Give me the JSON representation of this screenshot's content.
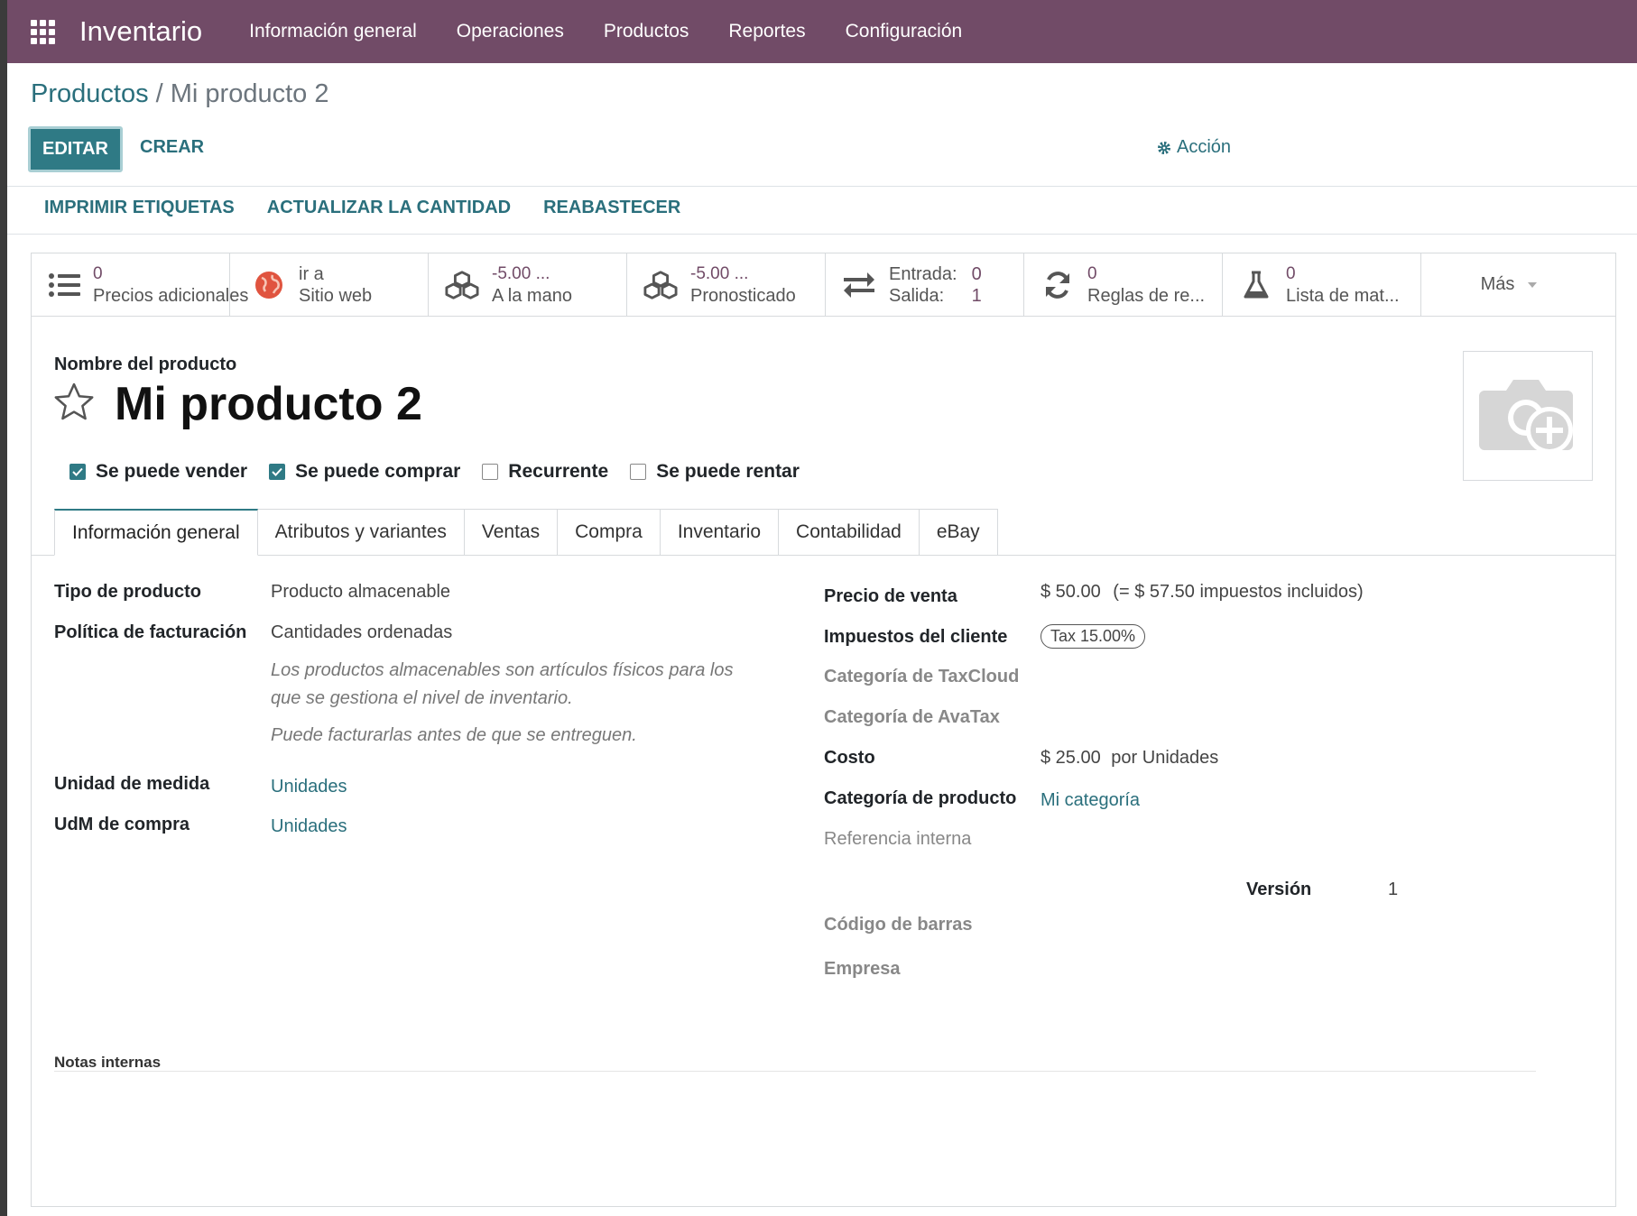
{
  "navbar": {
    "brand": "Inventario",
    "menu": [
      "Información general",
      "Operaciones",
      "Productos",
      "Reportes",
      "Configuración"
    ]
  },
  "breadcrumb": {
    "parent": "Productos",
    "separator": " / ",
    "current": "Mi producto 2"
  },
  "control": {
    "edit": "EDITAR",
    "create": "CREAR",
    "action": "Acción"
  },
  "statusbar_buttons": [
    "IMPRIMIR ETIQUETAS",
    "ACTUALIZAR LA CANTIDAD",
    "REABASTECER"
  ],
  "smart_buttons": {
    "extra_prices": {
      "value": "0",
      "label": "Precios adicionales",
      "icon": "list-icon"
    },
    "website": {
      "value": "ir a",
      "label": "Sitio web",
      "icon": "globe-icon"
    },
    "on_hand": {
      "value": "-5.00 ...",
      "label": "A la mano",
      "icon": "cubes-icon"
    },
    "forecast": {
      "value": "-5.00 ...",
      "label": "Pronosticado",
      "icon": "cubes-icon"
    },
    "in_out": {
      "in_label": "Entrada:",
      "in_value": "0",
      "out_label": "Salida:",
      "out_value": "1",
      "icon": "exchange-icon"
    },
    "reorder": {
      "value": "0",
      "label": "Reglas de re...",
      "icon": "refresh-icon"
    },
    "bom": {
      "value": "0",
      "label": "Lista de mat...",
      "icon": "flask-icon"
    },
    "more": "Más"
  },
  "product": {
    "name_label": "Nombre del producto",
    "name": "Mi producto 2",
    "checks": [
      {
        "label": "Se puede vender",
        "checked": true
      },
      {
        "label": "Se puede comprar",
        "checked": true
      },
      {
        "label": "Recurrente",
        "checked": false
      },
      {
        "label": "Se puede rentar",
        "checked": false
      }
    ]
  },
  "tabs": [
    "Información general",
    "Atributos y variantes",
    "Ventas",
    "Compra",
    "Inventario",
    "Contabilidad",
    "eBay"
  ],
  "left_group": {
    "type_label": "Tipo de producto",
    "type_value": "Producto almacenable",
    "invoice_label": "Política de facturación",
    "invoice_value": "Cantidades ordenadas",
    "help1": "Los productos almacenables son artículos físicos para los que se gestiona el nivel de inventario.",
    "help2": "Puede facturarlas antes de que se entreguen.",
    "uom_label": "Unidad de medida",
    "uom_value": "Unidades",
    "uom_po_label": "UdM de compra",
    "uom_po_value": "Unidades"
  },
  "right_group": {
    "price_label": "Precio de venta",
    "price_value": "$ 50.00",
    "price_taxed": "(= $ 57.50 impuestos incluidos)",
    "taxes_label": "Impuestos del cliente",
    "taxes_badge": "Tax 15.00%",
    "taxcloud_label": "Categoría de TaxCloud",
    "avatax_label": "Categoría de AvaTax",
    "cost_label": "Costo",
    "cost_value": "$ 25.00",
    "cost_unit": "por Unidades",
    "categ_label": "Categoría de producto",
    "categ_value": "Mi categoría",
    "ref_label": "Referencia interna",
    "version_label": "Versión",
    "version_value": "1",
    "barcode_label": "Código de barras",
    "company_label": "Empresa"
  },
  "notes_label": "Notas internas"
}
